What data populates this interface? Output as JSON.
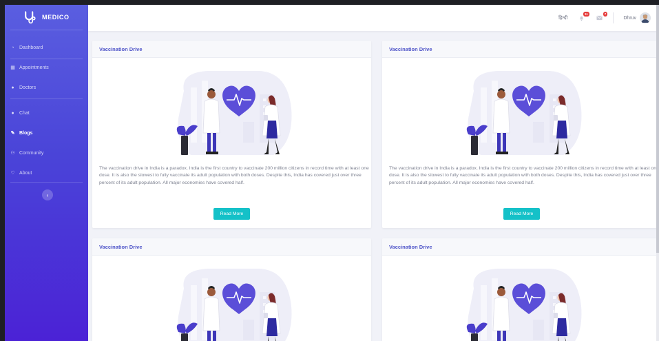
{
  "brand": {
    "name": "MEDICO"
  },
  "sidebar": {
    "items": [
      {
        "label": "Dashboard",
        "icon": "dashboard-icon"
      },
      {
        "label": "Appointments",
        "icon": "calendar-icon"
      },
      {
        "label": "Doctors",
        "icon": "doctor-icon"
      },
      {
        "label": "Chat",
        "icon": "chat-icon"
      },
      {
        "label": "Blogs",
        "icon": "blog-icon",
        "active": true
      },
      {
        "label": "Community",
        "icon": "community-icon"
      },
      {
        "label": "About",
        "icon": "about-icon"
      }
    ],
    "toggle_icon": "chevron-left-icon"
  },
  "topbar": {
    "language": "हिन्दी",
    "alerts_badge": "3+",
    "messages_badge": "7",
    "user_name": "Dhruv"
  },
  "cards": [
    {
      "title": "Vaccination Drive",
      "body": "The vaccination drive in India is a paradox. India is the first country to vaccinate 200 million citizens in record time with at least one dose. It is also the slowest to fully vaccinate its adult population with both doses. Despite this, India has covered just over three percent of its adult population. All major economies have covered half.",
      "button": "Read More"
    },
    {
      "title": "Vaccination Drive",
      "body": "The vaccination drive in India is a paradox. India is the first country to vaccinate 200 million citizens in record time with at least one dose. It is also the slowest to fully vaccinate its adult population with both doses. Despite this, India has covered just over three percent of its adult population. All major economies have covered half.",
      "button": "Read More"
    },
    {
      "title": "Vaccination Drive"
    },
    {
      "title": "Vaccination Drive"
    }
  ],
  "colors": {
    "sidebar_top": "#5a5ee0",
    "sidebar_bottom": "#4b22d6",
    "accent_title": "#4e54c8",
    "button": "#14c1c8",
    "heart": "#5b4ed8"
  }
}
